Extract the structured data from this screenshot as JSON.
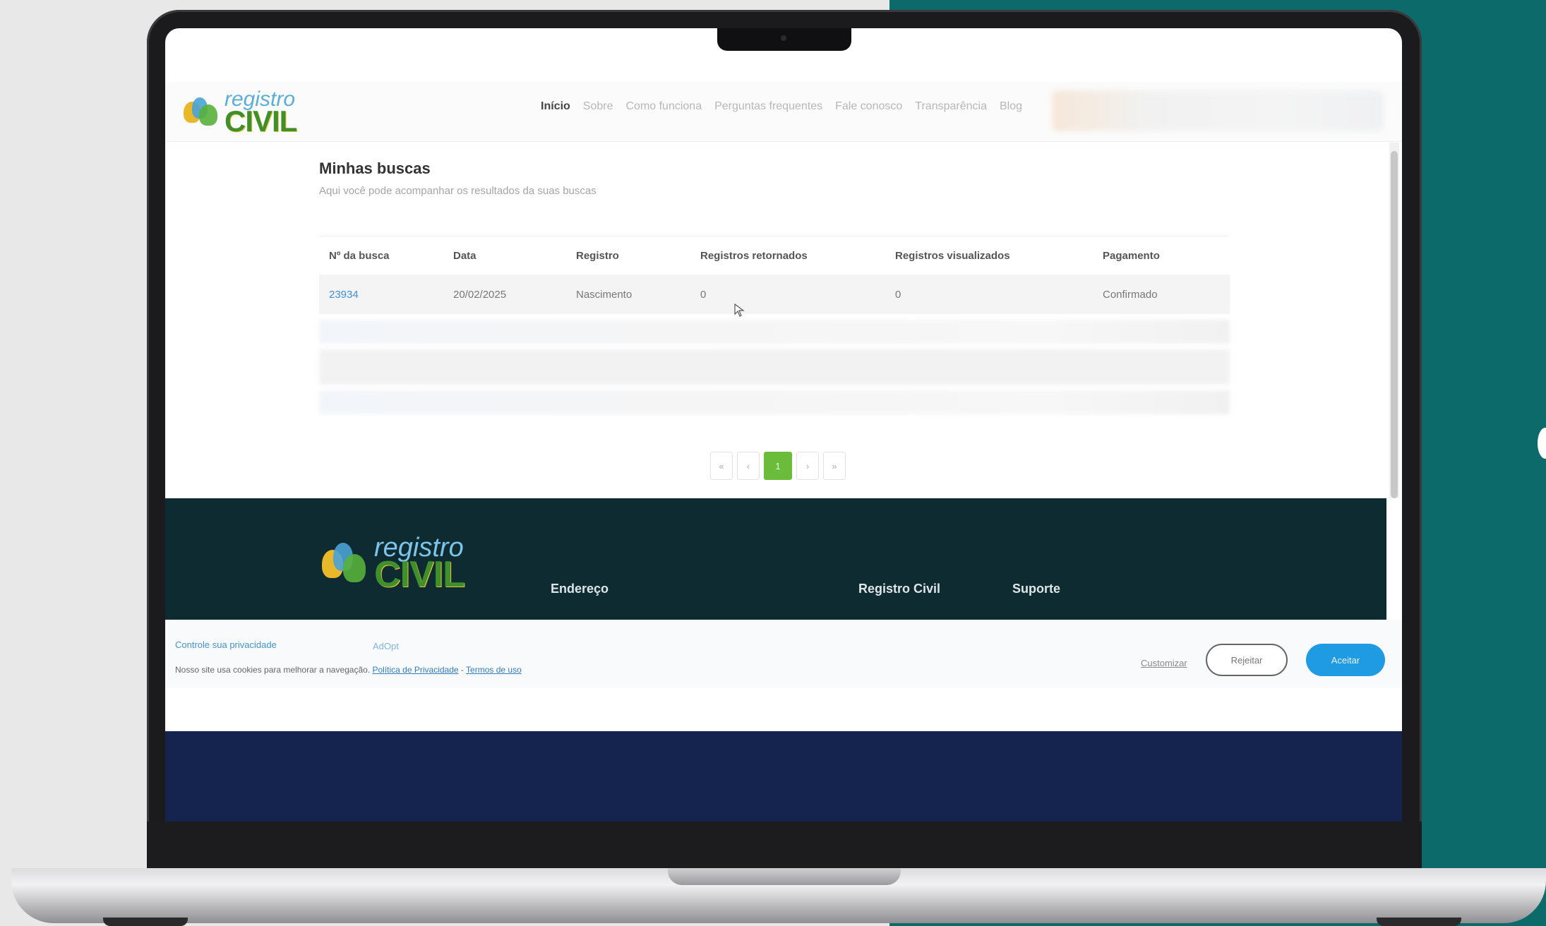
{
  "header": {
    "logo_small": "registro",
    "logo_big": "CIVIL",
    "nav": [
      "Início",
      "Sobre",
      "Como funciona",
      "Perguntas frequentes",
      "Fale conosco",
      "Transparência",
      "Blog"
    ]
  },
  "main": {
    "title": "Minhas buscas",
    "subtitle": "Aqui você pode acompanhar os resultados da suas buscas",
    "table": {
      "headers": [
        "Nº da busca",
        "Data",
        "Registro",
        "Registros retornados",
        "Registros visualizados",
        "Pagamento"
      ],
      "rows": [
        [
          "23934",
          "20/02/2025",
          "Nascimento",
          "0",
          "0",
          "Confirmado"
        ]
      ]
    },
    "pagination": {
      "first": "«",
      "prev": "‹",
      "current": "1",
      "next": "›",
      "last": "»"
    }
  },
  "footer": {
    "logo_small": "registro",
    "logo_big": "CIVIL",
    "headings": [
      "Endereço",
      "Registro Civil",
      "Suporte"
    ]
  },
  "cookie": {
    "privacy_label": "Controle sua privacidade",
    "adopt_label": "AdOpt",
    "message": "Nosso site usa cookies para melhorar a navegação.",
    "privacy_policy": "Política de Privacidade",
    "separator": "-",
    "terms": "Termos de uso",
    "customize": "Customizar",
    "reject": "Rejeitar",
    "accept": "Aceitar"
  },
  "colors": {
    "accent_green": "#6cbc3c",
    "link_blue": "#3d8fd6",
    "footer_bg": "#0e2b31",
    "accept_blue": "#1e9be3",
    "teal_background": "#0c6a6b"
  },
  "icons": {
    "cursor": "mouse-pointer-icon"
  }
}
